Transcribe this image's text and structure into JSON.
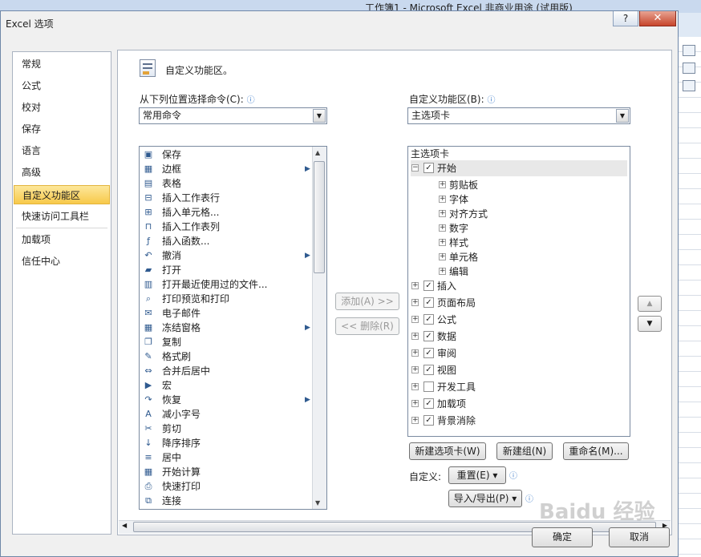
{
  "background": {
    "title": "工作簿1 - Microsoft Excel 非商业用途 (试用版)"
  },
  "dialog": {
    "title": "Excel 选项",
    "help": "?",
    "close": "✕"
  },
  "nav": {
    "items": [
      "常规",
      "公式",
      "校对",
      "保存",
      "语言",
      "高级",
      "自定义功能区",
      "快速访问工具栏",
      "加载项",
      "信任中心"
    ],
    "selected_index": 6
  },
  "header": {
    "title": "自定义功能区。"
  },
  "left": {
    "label": "从下列位置选择命令(C):",
    "combo_value": "常用命令",
    "commands": [
      {
        "label": "保存",
        "icon": "save-icon"
      },
      {
        "label": "边框",
        "icon": "border-icon",
        "sub": true
      },
      {
        "label": "表格",
        "icon": "table-icon"
      },
      {
        "label": "插入工作表行",
        "icon": "insert-row-icon"
      },
      {
        "label": "插入单元格...",
        "icon": "insert-cell-icon"
      },
      {
        "label": "插入工作表列",
        "icon": "insert-column-icon"
      },
      {
        "label": "插入函数...",
        "icon": "function-icon"
      },
      {
        "label": "撤消",
        "icon": "undo-icon",
        "sub": true
      },
      {
        "label": "打开",
        "icon": "open-folder-icon"
      },
      {
        "label": "打开最近使用过的文件...",
        "icon": "recent-file-icon"
      },
      {
        "label": "打印预览和打印",
        "icon": "print-preview-icon"
      },
      {
        "label": "电子邮件",
        "icon": "email-icon"
      },
      {
        "label": "冻结窗格",
        "icon": "freeze-panes-icon",
        "sub": true
      },
      {
        "label": "复制",
        "icon": "copy-icon"
      },
      {
        "label": "格式刷",
        "icon": "format-painter-icon"
      },
      {
        "label": "合并后居中",
        "icon": "merge-center-icon"
      },
      {
        "label": "宏",
        "icon": "macro-icon"
      },
      {
        "label": "恢复",
        "icon": "redo-icon",
        "sub": true
      },
      {
        "label": "减小字号",
        "icon": "decrease-font-icon"
      },
      {
        "label": "剪切",
        "icon": "cut-icon"
      },
      {
        "label": "降序排序",
        "icon": "sort-desc-icon"
      },
      {
        "label": "居中",
        "icon": "align-center-icon"
      },
      {
        "label": "开始计算",
        "icon": "calculate-icon"
      },
      {
        "label": "快速打印",
        "icon": "quick-print-icon"
      },
      {
        "label": "连接",
        "icon": "connections-icon"
      }
    ]
  },
  "middle": {
    "add": "添加(A) >>",
    "remove": "<< 删除(R)"
  },
  "right": {
    "label": "自定义功能区(B):",
    "combo_value": "主选项卡",
    "tree_header": "主选项卡",
    "tree": [
      {
        "label": "开始",
        "level": 0,
        "checked": true,
        "expanded": true
      },
      {
        "label": "剪贴板",
        "level": 1
      },
      {
        "label": "字体",
        "level": 1
      },
      {
        "label": "对齐方式",
        "level": 1
      },
      {
        "label": "数字",
        "level": 1
      },
      {
        "label": "样式",
        "level": 1
      },
      {
        "label": "单元格",
        "level": 1
      },
      {
        "label": "编辑",
        "level": 1
      },
      {
        "label": "插入",
        "level": 0,
        "checked": true
      },
      {
        "label": "页面布局",
        "level": 0,
        "checked": true
      },
      {
        "label": "公式",
        "level": 0,
        "checked": true
      },
      {
        "label": "数据",
        "level": 0,
        "checked": true
      },
      {
        "label": "审阅",
        "level": 0,
        "checked": true
      },
      {
        "label": "视图",
        "level": 0,
        "checked": true
      },
      {
        "label": "开发工具",
        "level": 0,
        "checked": false
      },
      {
        "label": "加载项",
        "level": 0,
        "checked": true
      },
      {
        "label": "背景消除",
        "level": 0,
        "checked": true
      }
    ],
    "new_tab": "新建选项卡(W)",
    "new_group": "新建组(N)",
    "rename": "重命名(M)...",
    "customize_label": "自定义:",
    "reset": "重置(E) ▾",
    "import_export": "导入/导出(P) ▾"
  },
  "footer": {
    "ok": "确定",
    "cancel": "取消"
  },
  "watermark": "Baidu 经验"
}
